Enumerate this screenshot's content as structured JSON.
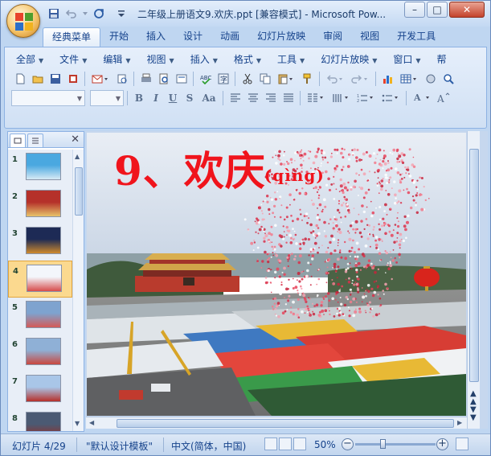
{
  "window": {
    "title": "二年级上册语文9.欢庆.ppt [兼容模式] - Microsoft Pow...",
    "controls": {
      "minimize": "–",
      "maximize": "□",
      "close": "✕"
    }
  },
  "ribbon": {
    "tabs": [
      {
        "label": "经典菜单",
        "active": true
      },
      {
        "label": "开始"
      },
      {
        "label": "插入"
      },
      {
        "label": "设计"
      },
      {
        "label": "动画"
      },
      {
        "label": "幻灯片放映"
      },
      {
        "label": "审阅"
      },
      {
        "label": "视图"
      },
      {
        "label": "开发工具"
      }
    ],
    "menus": [
      {
        "label": "全部"
      },
      {
        "label": "文件"
      },
      {
        "label": "编辑"
      },
      {
        "label": "视图"
      },
      {
        "label": "插入"
      },
      {
        "label": "格式"
      },
      {
        "label": "工具"
      },
      {
        "label": "幻灯片放映"
      },
      {
        "label": "窗口"
      },
      {
        "label": "帮"
      }
    ],
    "format_buttons": {
      "bold": "B",
      "italic": "I",
      "underline": "U",
      "strike": "S",
      "case": "Aa"
    }
  },
  "slides_pane": {
    "tab_outline_icon": "outline-icon",
    "tab_slides_icon": "slides-icon",
    "close_glyph": "✕",
    "thumbnails": [
      {
        "number": "1",
        "selected": false,
        "colors": [
          "#4aa8e0",
          "#d6e9f5"
        ]
      },
      {
        "number": "2",
        "selected": false,
        "colors": [
          "#b5312a",
          "#e7c36a"
        ]
      },
      {
        "number": "3",
        "selected": false,
        "colors": [
          "#1d2a55",
          "#cf8a2c"
        ]
      },
      {
        "number": "4",
        "selected": true,
        "colors": [
          "#f3f6fb",
          "#d74b4b"
        ]
      },
      {
        "number": "5",
        "selected": false,
        "colors": [
          "#7ea3cf",
          "#d45a57"
        ]
      },
      {
        "number": "6",
        "selected": false,
        "colors": [
          "#8fb0d6",
          "#c9473f"
        ]
      },
      {
        "number": "7",
        "selected": false,
        "colors": [
          "#a9c6e8",
          "#b6302a"
        ]
      },
      {
        "number": "8",
        "selected": false,
        "colors": [
          "#4b5a73",
          "#9a2b22"
        ]
      }
    ]
  },
  "slide": {
    "heading": "9、欢庆",
    "pinyin": "(qìng)"
  },
  "statusbar": {
    "slide_position": "幻灯片 4/29",
    "theme": "\"默认设计模板\"",
    "language": "中文(简体，中国)",
    "zoom": "50%",
    "zoom_fraction": 0.34
  },
  "colors": {
    "accent": "#15428b",
    "heading_red": "#f0141c"
  }
}
